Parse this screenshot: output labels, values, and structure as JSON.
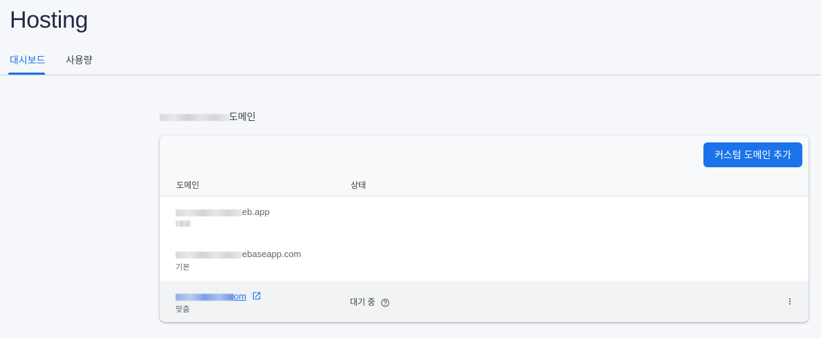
{
  "page": {
    "title": "Hosting"
  },
  "tabs": [
    {
      "label": "대시보드",
      "active": true
    },
    {
      "label": "사용량",
      "active": false
    }
  ],
  "section": {
    "title_suffix": "도메인"
  },
  "card": {
    "add_button_label": "커스텀 도메인 추가",
    "columns": {
      "domain": "도메인",
      "status": "상태"
    },
    "rows": [
      {
        "domain_suffix": "eb.app",
        "sublabel": "",
        "status": ""
      },
      {
        "domain_suffix": "ebaseapp.com",
        "sublabel": "기본",
        "status": ""
      },
      {
        "domain_suffix": "om",
        "sublabel": "맞춤",
        "status": "대기 중"
      }
    ]
  },
  "icons": {
    "external_link": "open-in-new-icon",
    "help": "help-circle-icon",
    "more": "more-vert-icon"
  },
  "colors": {
    "accent": "#1a73e8",
    "title": "#1f2a44",
    "background": "#f5f7fa"
  }
}
